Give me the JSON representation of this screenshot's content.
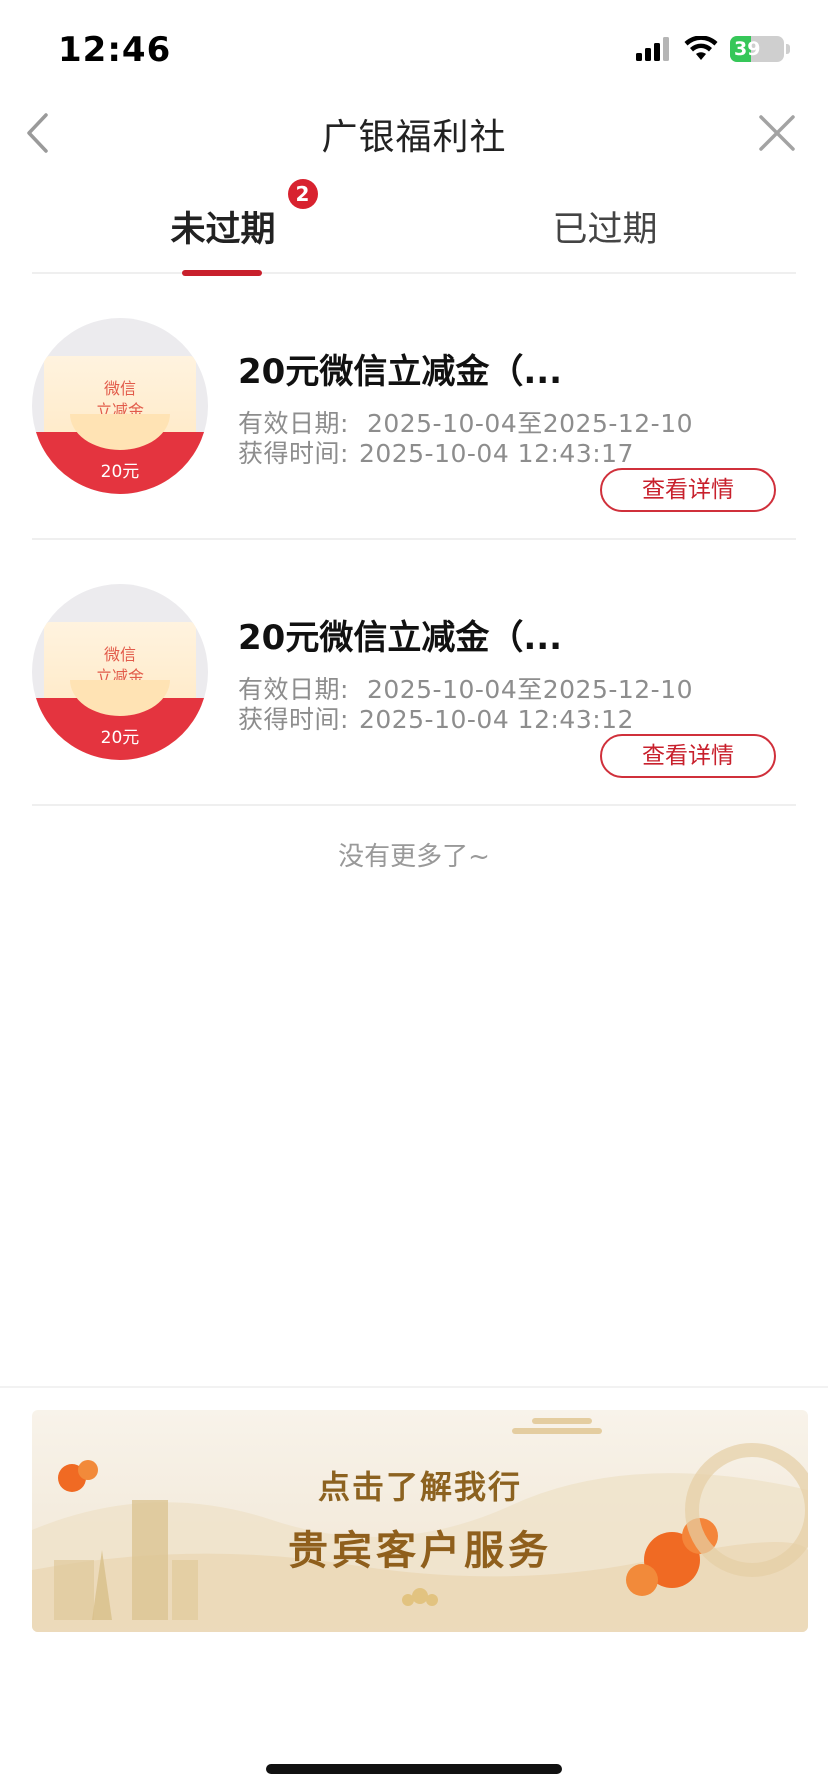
{
  "status": {
    "time": "12:46",
    "battery": "39",
    "battery_level": 0.39
  },
  "nav": {
    "title": "广银福利社"
  },
  "tabs": [
    {
      "label": "未过期",
      "badge": "2",
      "active": true
    },
    {
      "label": "已过期",
      "active": false
    }
  ],
  "coupons": [
    {
      "thumb_line1": "微信",
      "thumb_line2": "立减金",
      "thumb_amount": "20元",
      "title": "20元微信立减金（...",
      "valid_label": "有效日期:",
      "valid_range": "2025-10-04至2025-12-10",
      "obtained_label": "获得时间:",
      "obtained_time": "2025-10-04 12:43:17",
      "detail_button": "查看详情"
    },
    {
      "thumb_line1": "微信",
      "thumb_line2": "立减金",
      "thumb_amount": "20元",
      "title": "20元微信立减金（...",
      "valid_label": "有效日期:",
      "valid_range": "2025-10-04至2025-12-10",
      "obtained_label": "获得时间:",
      "obtained_time": "2025-10-04 12:43:12",
      "detail_button": "查看详情"
    }
  ],
  "list_end": "没有更多了~",
  "banner": {
    "line1": "点击了解我行",
    "line2": "贵宾客户服务"
  },
  "colors": {
    "accent": "#c8202c",
    "badge": "#d8222f",
    "battery": "#36c759"
  },
  "icons": [
    "signal-icon",
    "wifi-icon",
    "battery-icon",
    "back-chevron-icon",
    "close-icon"
  ]
}
